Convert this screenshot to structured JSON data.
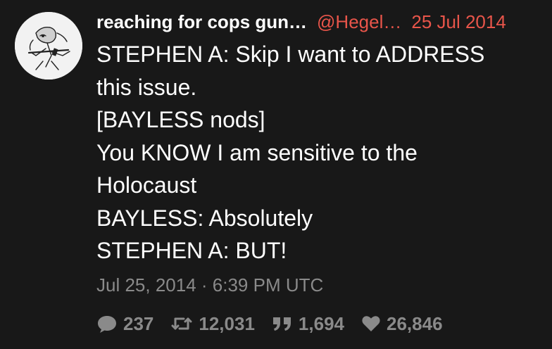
{
  "tweet": {
    "display_name": "reaching for cops gun…",
    "handle": "@Hegel…",
    "date": "25 Jul 2014",
    "lines": [
      "STEPHEN A: Skip I want to ADDRESS",
      "this issue.",
      "[BAYLESS nods]",
      "You KNOW I am sensitive to the",
      "Holocaust",
      "BAYLESS: Absolutely",
      "STEPHEN A: BUT!"
    ],
    "timestamp": "Jul 25, 2014 · 6:39 PM UTC",
    "stats": {
      "replies": "237",
      "retweets": "12,031",
      "quotes": "1,694",
      "likes": "26,846"
    },
    "icons": {
      "reply": "comment-icon",
      "retweet": "retweet-icon",
      "quote": "quote-icon",
      "like": "heart-icon"
    },
    "colors": {
      "background": "#181818",
      "accent": "#e8554a",
      "muted": "#8a8a8a",
      "text": "#ffffff"
    }
  }
}
